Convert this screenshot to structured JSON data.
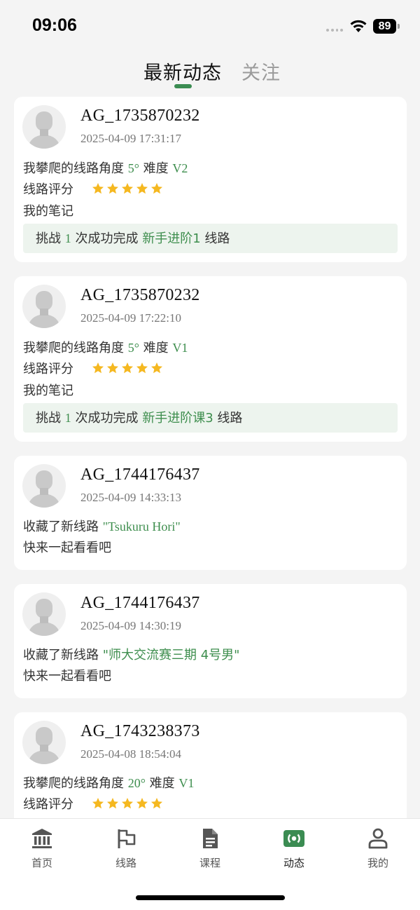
{
  "status_bar": {
    "time": "09:06",
    "battery": "89"
  },
  "tabs": [
    {
      "label": "最新动态",
      "active": true
    },
    {
      "label": "关注",
      "active": false
    }
  ],
  "colors": {
    "accent": "#3e8e4e",
    "star": "#f5b820",
    "challenge_bg": "#edf4ee"
  },
  "feed": [
    {
      "username": "AG_1735870232",
      "time": "2025-04-09 17:31:17",
      "climb_prefix": "我攀爬的线路角度",
      "angle": "5°",
      "difficulty_label": "难度",
      "difficulty": "V2",
      "rating_label": "线路评分",
      "rating": 5,
      "note": "我的笔记",
      "challenge_prefix": "挑战",
      "challenge_count": "1",
      "challenge_middle": "次成功完成",
      "route_name": "新手进阶1",
      "challenge_suffix": "线路"
    },
    {
      "username": "AG_1735870232",
      "time": "2025-04-09 17:22:10",
      "climb_prefix": "我攀爬的线路角度",
      "angle": "5°",
      "difficulty_label": "难度",
      "difficulty": "V1",
      "rating_label": "线路评分",
      "rating": 5,
      "note": "我的笔记",
      "challenge_prefix": "挑战",
      "challenge_count": "1",
      "challenge_middle": "次成功完成",
      "route_name": "新手进阶课3",
      "challenge_suffix": "线路"
    },
    {
      "username": "AG_1744176437",
      "time": "2025-04-09 14:33:13",
      "collect_prefix": "收藏了新线路",
      "route_name": "\"Tsukuru Hori\"",
      "invite": "快来一起看看吧"
    },
    {
      "username": "AG_1744176437",
      "time": "2025-04-09 14:30:19",
      "collect_prefix": "收藏了新线路",
      "route_name": "\"师大交流赛三期 4号男\"",
      "invite": "快来一起看看吧"
    },
    {
      "username": "AG_1743238373",
      "time": "2025-04-08 18:54:04",
      "climb_prefix": "我攀爬的线路角度",
      "angle": "20°",
      "difficulty_label": "难度",
      "difficulty": "V1",
      "rating_label": "线路评分",
      "rating": 5
    }
  ],
  "bottom_nav": [
    {
      "label": "首页",
      "icon": "bank-icon",
      "active": false
    },
    {
      "label": "线路",
      "icon": "flag-icon",
      "active": false
    },
    {
      "label": "课程",
      "icon": "document-icon",
      "active": false
    },
    {
      "label": "动态",
      "icon": "broadcast-icon",
      "active": true
    },
    {
      "label": "我的",
      "icon": "person-icon",
      "active": false
    }
  ]
}
